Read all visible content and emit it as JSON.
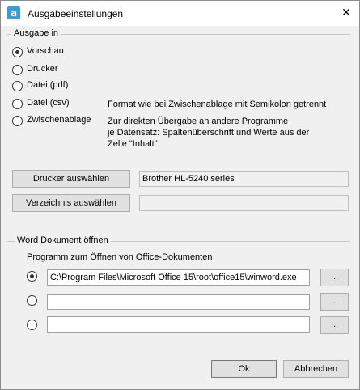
{
  "window": {
    "title": "Ausgabeeinstellungen",
    "close_glyph": "✕"
  },
  "output": {
    "group_label": "Ausgabe in",
    "options": [
      {
        "label": "Vorschau",
        "checked": true
      },
      {
        "label": "Drucker",
        "checked": false
      },
      {
        "label": "Datei (pdf)",
        "checked": false
      },
      {
        "label": "Datei (csv)",
        "checked": false,
        "description": [
          "Format wie bei Zwischenablage mit Semikolon getrennt"
        ]
      },
      {
        "label": "Zwischenablage",
        "checked": false,
        "description": [
          "Zur direkten Übergabe an andere Programme",
          "je Datensatz: Spaltenüberschrift und Werte aus der",
          "Zelle \"Inhalt\""
        ]
      }
    ]
  },
  "printer": {
    "button_label": "Drucker auswählen",
    "value": "Brother HL-5240 series"
  },
  "directory": {
    "button_label": "Verzeichnis auswählen",
    "value": ""
  },
  "word": {
    "group_label": "Word Dokument öffnen",
    "programs_label": "Programm zum Öffnen von Office-Dokumenten",
    "programs": [
      {
        "checked": true,
        "path": "C:\\Program Files\\Microsoft Office 15\\root\\office15\\winword.exe",
        "browse_label": "..."
      },
      {
        "checked": false,
        "path": "",
        "browse_label": "..."
      },
      {
        "checked": false,
        "path": "",
        "browse_label": "..."
      }
    ]
  },
  "footer": {
    "ok_label": "Ok",
    "cancel_label": "Abbrechen"
  }
}
